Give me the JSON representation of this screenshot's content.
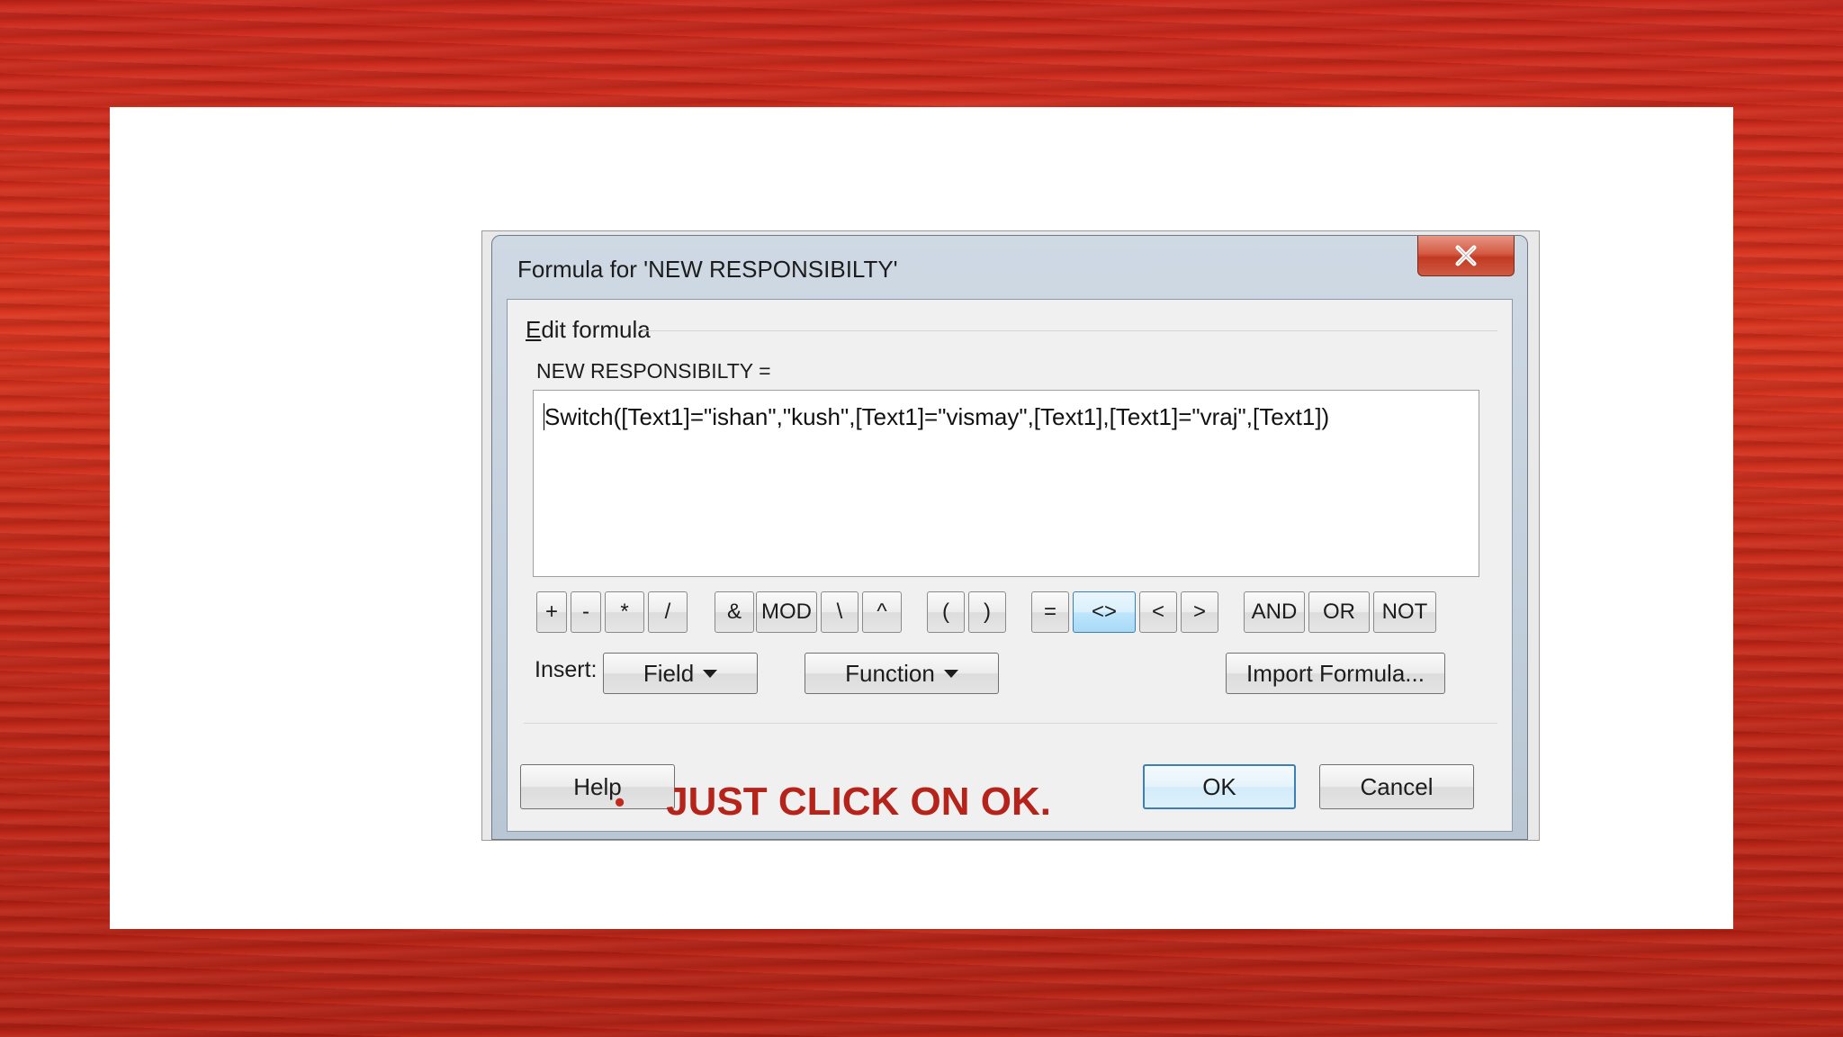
{
  "dialog": {
    "title": "Formula for 'NEW RESPONSIBILTY'",
    "group_label": "Edit formula",
    "field_label": "NEW RESPONSIBILTY =",
    "formula": "Switch([Text1]=\"ishan\",\"kush\",[Text1]=\"vismay\",[Text1],[Text1]=\"vraj\",[Text1])",
    "operators": [
      "+",
      "-",
      "*",
      "/",
      "&",
      "MOD",
      "\\",
      "^",
      "(",
      ")",
      "=",
      "<>",
      "<",
      ">",
      "AND",
      "OR",
      "NOT"
    ],
    "active_operator": "<>",
    "insert_label": "Insert:",
    "field_button": "Field",
    "function_button": "Function",
    "import_button": "Import Formula...",
    "help_button": "Help",
    "ok_button": "OK",
    "cancel_button": "Cancel"
  },
  "bullet": {
    "symbol": "•",
    "text": "JUST CLICK ON OK."
  },
  "colors": {
    "background_red": "#c8281c",
    "bullet_text": "#b5231a",
    "close_button": "#c23a22",
    "default_button_border": "#3c7fb1"
  },
  "icons": [
    "close-icon",
    "dropdown-arrow-icon"
  ]
}
